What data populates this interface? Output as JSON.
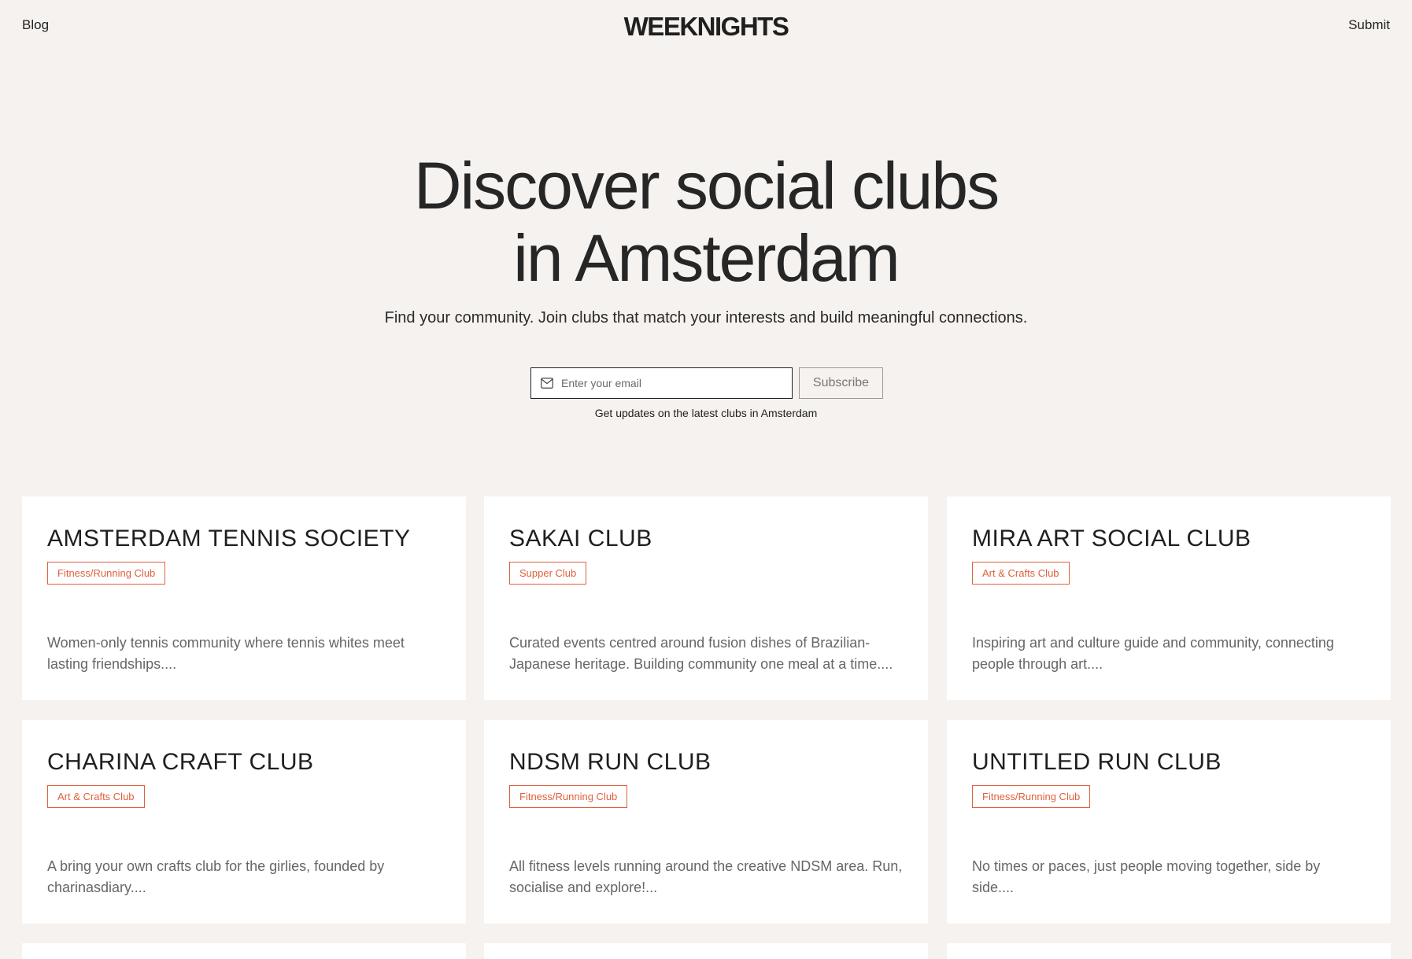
{
  "header": {
    "logo": "WEEKNIGHTS",
    "nav_left": "Blog",
    "nav_right": "Submit"
  },
  "hero": {
    "title_line1": "Discover social clubs",
    "title_line2": "in Amsterdam",
    "subtitle": "Find your community. Join clubs that match your interests and build meaningful connections."
  },
  "subscribe": {
    "email_placeholder": "Enter your email",
    "email_value": "",
    "button_label": "Subscribe",
    "note": "Get updates on the latest clubs in Amsterdam",
    "icon": "mail-icon"
  },
  "colors": {
    "background": "#f5f2ef",
    "card_background": "#ffffff",
    "tag_accent": "#e0603c",
    "text_primary": "#1f1f1f",
    "text_muted": "#666666"
  },
  "clubs": [
    {
      "name": "AMSTERDAM TENNIS SOCIETY",
      "category": "Fitness/Running Club",
      "description": "Women-only tennis community where tennis whites meet lasting friendships...."
    },
    {
      "name": "SAKAI CLUB",
      "category": "Supper Club",
      "description": "Curated events centred around fusion dishes of Brazilian-Japanese heritage. Building community one meal at a time...."
    },
    {
      "name": "MIRA ART SOCIAL CLUB",
      "category": "Art & Crafts Club",
      "description": "Inspiring art and culture guide and community, connecting people through art...."
    },
    {
      "name": "CHARINA CRAFT CLUB",
      "category": "Art & Crafts Club",
      "description": "A bring your own crafts club for the girlies, founded by charinasdiary...."
    },
    {
      "name": "NDSM RUN CLUB",
      "category": "Fitness/Running Club",
      "description": "All fitness levels running around the creative NDSM area. Run, socialise and explore!..."
    },
    {
      "name": "UNTITLED RUN CLUB",
      "category": "Fitness/Running Club",
      "description": "No times or paces, just people moving together, side by side...."
    }
  ]
}
